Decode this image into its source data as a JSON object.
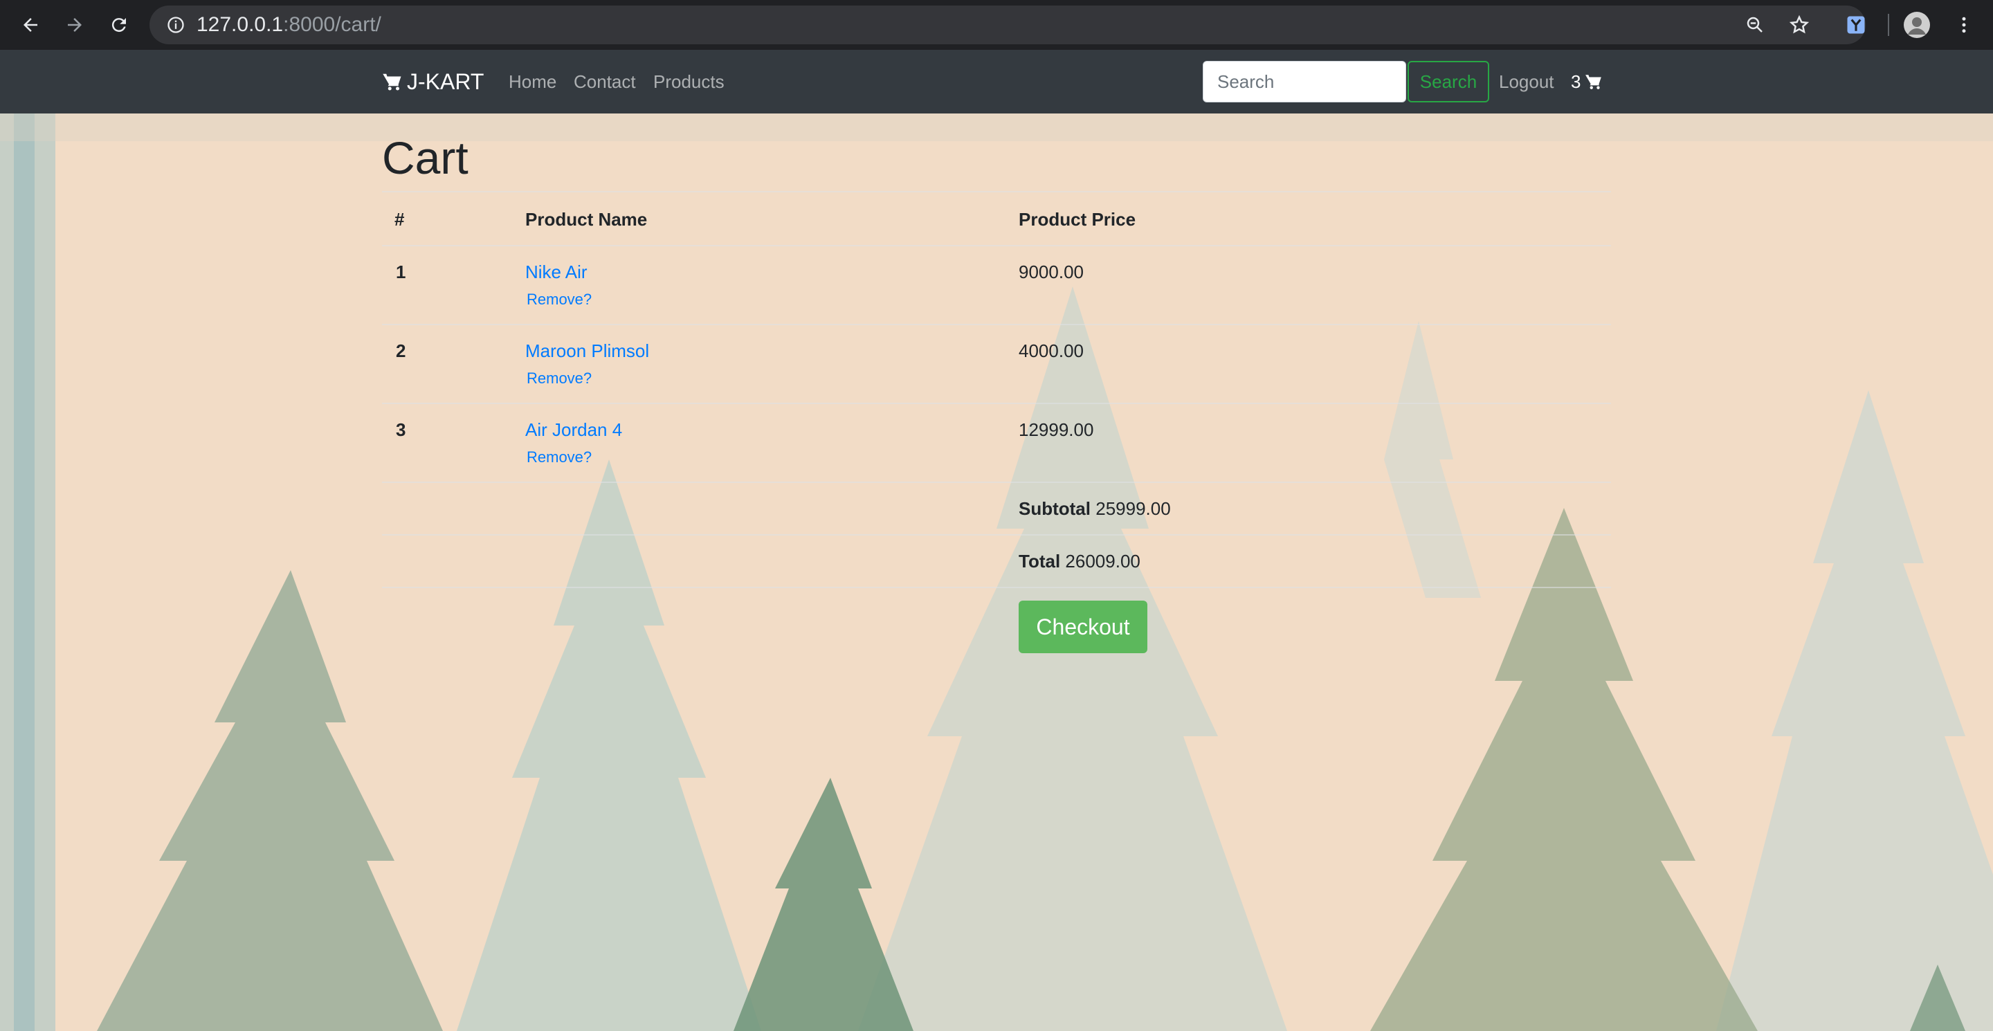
{
  "browser": {
    "url_host": "127.0.0.1",
    "url_rest": ":8000/cart/",
    "icons": [
      "back-arrow-icon",
      "forward-arrow-icon",
      "reload-icon",
      "info-icon",
      "zoom-icon",
      "star-icon",
      "extension-icon",
      "profile-avatar",
      "menu-dots-icon"
    ]
  },
  "navbar": {
    "brand": "J-KART",
    "links": [
      "Home",
      "Contact",
      "Products"
    ],
    "search_placeholder": "Search",
    "search_button": "Search",
    "logout": "Logout",
    "cart_count": "3"
  },
  "page": {
    "title": "Cart"
  },
  "table": {
    "headers": [
      "#",
      "Product Name",
      "Product Price"
    ],
    "rows": [
      {
        "num": "1",
        "name": "Nike Air",
        "remove": "Remove?",
        "price": "9000.00"
      },
      {
        "num": "2",
        "name": "Maroon Plimsol",
        "remove": "Remove?",
        "price": "4000.00"
      },
      {
        "num": "3",
        "name": "Air Jordan 4",
        "remove": "Remove?",
        "price": "12999.00"
      }
    ],
    "subtotal_label": "Subtotal",
    "subtotal_value": "25999.00",
    "total_label": "Total",
    "total_value": "26009.00"
  },
  "checkout_button": "Checkout",
  "colors": {
    "navbar_bg": "#343a40",
    "link": "#007bff",
    "success": "#5cb85c",
    "search_outline": "#28a745",
    "page_bg": "#f2dcc6"
  }
}
